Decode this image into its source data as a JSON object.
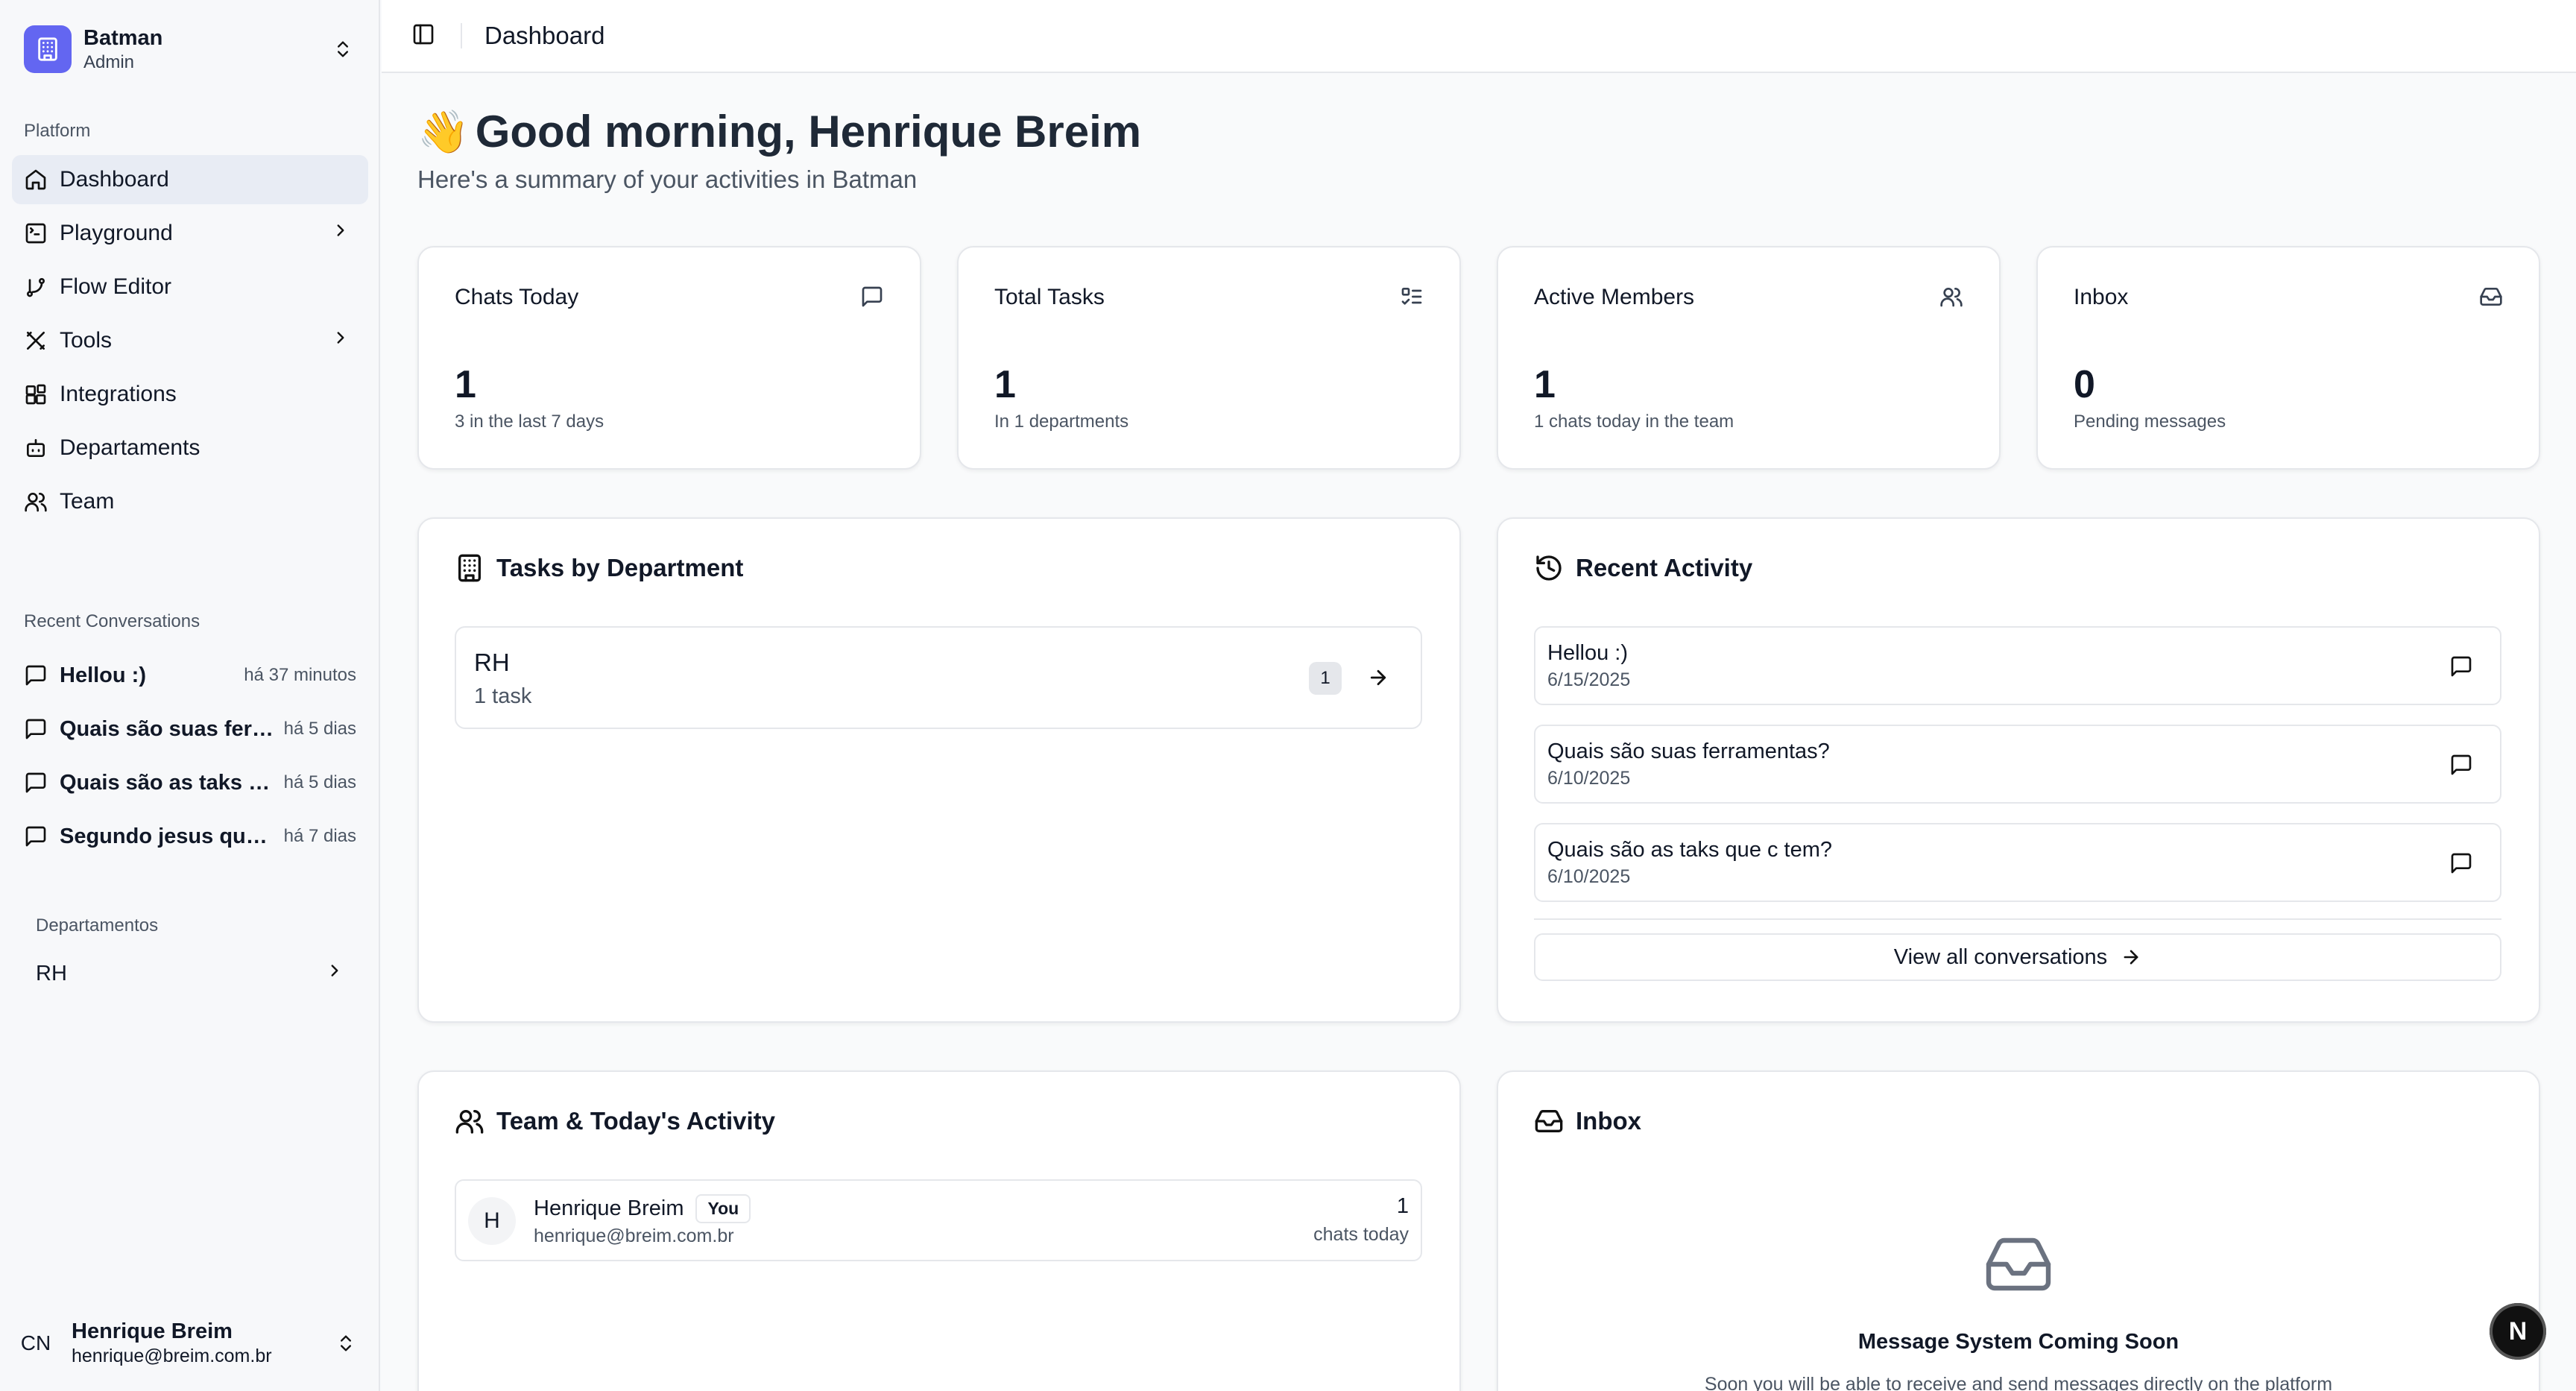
{
  "workspace": {
    "name": "Batman",
    "role": "Admin"
  },
  "sidebar": {
    "platform_label": "Platform",
    "nav": [
      {
        "label": "Dashboard",
        "icon": "home-icon",
        "active": true
      },
      {
        "label": "Playground",
        "icon": "terminal-icon"
      },
      {
        "label": "Flow Editor",
        "icon": "git-branch-icon"
      },
      {
        "label": "Tools",
        "icon": "tools-icon"
      },
      {
        "label": "Integrations",
        "icon": "blocks-icon"
      },
      {
        "label": "Departaments",
        "icon": "bot-icon"
      },
      {
        "label": "Team",
        "icon": "users-icon"
      }
    ],
    "recent_label": "Recent Conversations",
    "conversations": [
      {
        "title": "Hellou :)",
        "time": "há 37 minutos"
      },
      {
        "title": "Quais são suas ferramentas?",
        "time": "há 5 dias"
      },
      {
        "title": "Quais são as taks que c tem?",
        "time": "há 5 dias"
      },
      {
        "title": "Segundo jesus que ...",
        "time": "há 7 dias"
      }
    ],
    "departments_label": "Departamentos",
    "departments": [
      {
        "label": "RH"
      }
    ],
    "user": {
      "initials": "CN",
      "name": "Henrique Breim",
      "email": "henrique@breim.com.br"
    }
  },
  "header": {
    "breadcrumb": "Dashboard"
  },
  "main": {
    "greeting_emoji": "👋",
    "greeting": "Good morning, Henrique Breim",
    "subtitle": "Here's a summary of your activities in Batman",
    "stats": [
      {
        "title": "Chats Today",
        "value": "1",
        "sub": "3 in the last 7 days"
      },
      {
        "title": "Total Tasks",
        "value": "1",
        "sub": "In 1 departments"
      },
      {
        "title": "Active Members",
        "value": "1",
        "sub": "1 chats today in the team"
      },
      {
        "title": "Inbox",
        "value": "0",
        "sub": "Pending messages"
      }
    ],
    "tasks_by_department": {
      "title": "Tasks by Department",
      "rows": [
        {
          "name": "RH",
          "tasks_label": "1 task",
          "count": "1"
        }
      ]
    },
    "recent_activity": {
      "title": "Recent Activity",
      "items": [
        {
          "title": "Hellou :)",
          "date": "6/15/2025"
        },
        {
          "title": "Quais são suas ferramentas?",
          "date": "6/10/2025"
        },
        {
          "title": "Quais são as taks que c tem?",
          "date": "6/10/2025"
        }
      ],
      "view_all": "View all conversations"
    },
    "team": {
      "title": "Team & Today's Activity",
      "members": [
        {
          "initial": "H",
          "name": "Henrique Breim",
          "badge": "You",
          "email": "henrique@breim.com.br",
          "count": "1",
          "count_label": "chats today"
        }
      ]
    },
    "inbox": {
      "title": "Inbox",
      "empty_title": "Message System Coming Soon",
      "empty_text": "Soon you will be able to receive and send messages directly on the platform"
    }
  },
  "fab": {
    "label": "N"
  },
  "colors": {
    "accent": "#6366f1",
    "active_nav": "#e8ecf4",
    "border": "#e5e7eb"
  }
}
